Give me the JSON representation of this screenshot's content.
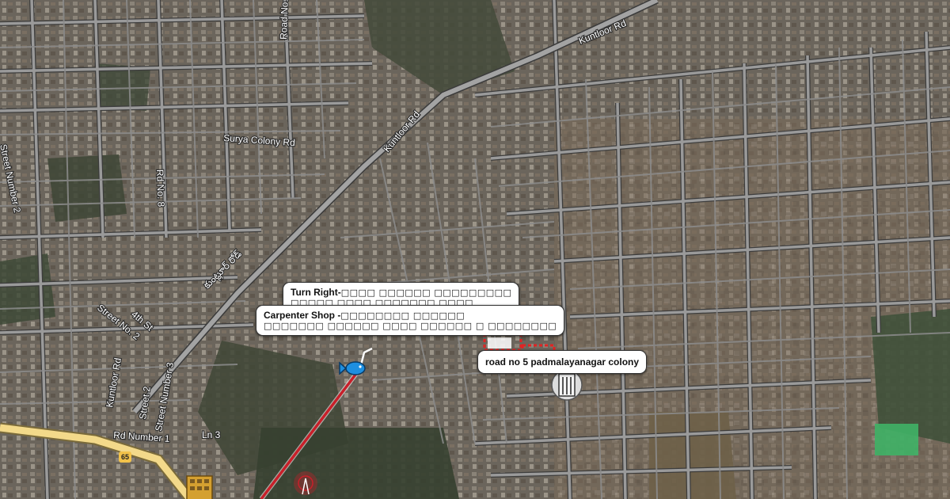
{
  "map": {
    "road_labels": [
      "Road No.",
      "Kuntloor Rd",
      "Kuntloor Rd",
      "Surya Colony Rd",
      "Street Number 2",
      "Rd No. 8",
      "కుంట్లూర్ రోడ్",
      "Street No. 2",
      "4th St",
      "Kuntloor Rd",
      "Street 2",
      "Street Number 3",
      "Rd Number 1",
      "Ln 3"
    ],
    "highway_shield": "65",
    "colors": {
      "aerial_base": "#5b5650",
      "road": "#9a9a9a",
      "road_edge": "#3b3b3b",
      "highway": "#f3d98a",
      "route": "#c8202a"
    }
  },
  "callouts": {
    "turn_right": {
      "title": "Turn Right-",
      "subtitle_telugu": "□□□□ □□□□□□ □□□□□□□□□",
      "line2": "□□□□□ □□□□ □□□□□□□ □□□□"
    },
    "carpenter_shop": {
      "title": "Carpenter Shop -",
      "title_telugu": "□□□□□□□□ □□□□□□",
      "line2": "□□□□□□□ □□□□□□ □□□□ □□□□□□ □ □□□□□□□□"
    },
    "destination": {
      "title": "road no 5 padmalayanagar colony"
    }
  },
  "markers": [
    {
      "name": "fish-marker-icon"
    },
    {
      "name": "building-marker-icon"
    },
    {
      "name": "bus-stop-icon"
    },
    {
      "name": "tower-icon"
    }
  ]
}
